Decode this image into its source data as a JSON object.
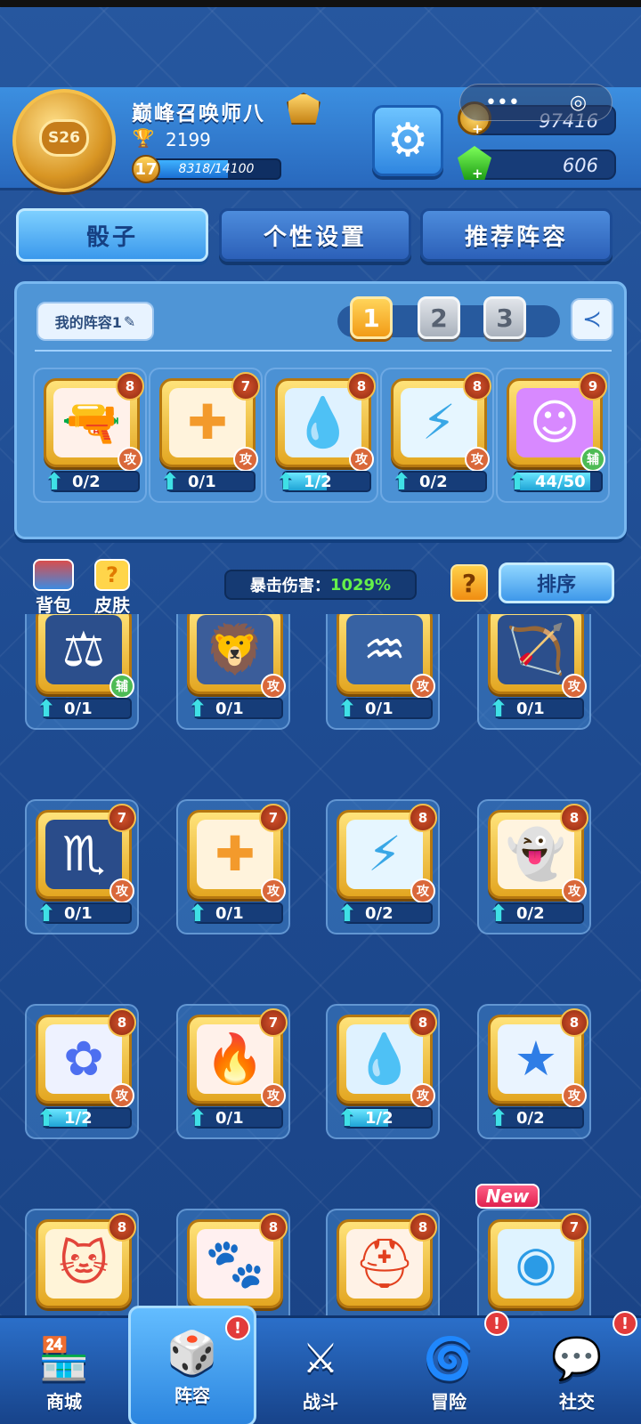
{
  "player": {
    "name": "巅峰召唤师八",
    "season_badge": "S26",
    "trophies": "2199",
    "level": "17",
    "xp_text": "8318/14100",
    "xp_fraction": 0.59
  },
  "currency": {
    "gold": "97416",
    "gems": "606"
  },
  "tabs": [
    {
      "label": "骰子",
      "active": true
    },
    {
      "label": "个性设置",
      "active": false
    },
    {
      "label": "推荐阵容",
      "active": false
    }
  ],
  "deck": {
    "name": "我的阵容1",
    "slots": [
      "1",
      "2",
      "3"
    ],
    "active_slot": 0,
    "cards": [
      {
        "icon": "🔫",
        "bg": "#fff1ea",
        "color": "#f05a28",
        "level": "8",
        "type": "攻",
        "type_kind": "atk",
        "progress": "0/2",
        "fill": 0
      },
      {
        "icon": "✚",
        "bg": "#fff3dc",
        "color": "#f39a2c",
        "level": "7",
        "type": "攻",
        "type_kind": "atk",
        "progress": "0/1",
        "fill": 0
      },
      {
        "icon": "💧",
        "bg": "#dff2ff",
        "color": "#2f9be6",
        "level": "8",
        "type": "攻",
        "type_kind": "atk",
        "progress": "1/2",
        "fill": 0.5
      },
      {
        "icon": "⚡",
        "bg": "#e6f6ff",
        "color": "#39a7e6",
        "level": "8",
        "type": "攻",
        "type_kind": "atk",
        "progress": "0/2",
        "fill": 0
      },
      {
        "icon": "☺",
        "bg": "#d889ff",
        "color": "#ffffff",
        "level": "9",
        "type": "辅",
        "type_kind": "sup",
        "progress": "44/50",
        "fill": 0.88
      }
    ]
  },
  "toolbar": {
    "bag_label": "背包",
    "skin_label": "皮肤",
    "crit_label": "暴击伤害：",
    "crit_value": "1029%",
    "help_label": "?",
    "sort_label": "排序"
  },
  "collection": [
    {
      "icon": "⚖",
      "bg": "#2c4f8c",
      "color": "#ffffff",
      "level": "",
      "type": "辅",
      "type_kind": "sup",
      "progress": "0/1",
      "fill": 0,
      "new": false
    },
    {
      "icon": "🦁",
      "bg": "#3b5d9a",
      "color": "#ffffff",
      "level": "",
      "type": "攻",
      "type_kind": "atk",
      "progress": "0/1",
      "fill": 0,
      "new": false
    },
    {
      "icon": "♒",
      "bg": "#3762a3",
      "color": "#ffffff",
      "level": "",
      "type": "攻",
      "type_kind": "atk",
      "progress": "0/1",
      "fill": 0,
      "new": false
    },
    {
      "icon": "🏹",
      "bg": "#2c4f8c",
      "color": "#ffffff",
      "level": "",
      "type": "攻",
      "type_kind": "atk",
      "progress": "0/1",
      "fill": 0,
      "new": false
    },
    {
      "icon": "♏",
      "bg": "#2a4c8a",
      "color": "#ffffff",
      "level": "7",
      "type": "攻",
      "type_kind": "atk",
      "progress": "0/1",
      "fill": 0,
      "new": false
    },
    {
      "icon": "✚",
      "bg": "#fff3dc",
      "color": "#f39a2c",
      "level": "7",
      "type": "攻",
      "type_kind": "atk",
      "progress": "0/1",
      "fill": 0,
      "new": false
    },
    {
      "icon": "⚡",
      "bg": "#e6f6ff",
      "color": "#39a7e6",
      "level": "8",
      "type": "攻",
      "type_kind": "atk",
      "progress": "0/2",
      "fill": 0,
      "new": false
    },
    {
      "icon": "👻",
      "bg": "#fff4df",
      "color": "#8b3df0",
      "level": "8",
      "type": "攻",
      "type_kind": "atk",
      "progress": "0/2",
      "fill": 0,
      "new": false
    },
    {
      "icon": "✿",
      "bg": "#eef2ff",
      "color": "#4d6ff0",
      "level": "8",
      "type": "攻",
      "type_kind": "atk",
      "progress": "1/2",
      "fill": 0.5,
      "new": false
    },
    {
      "icon": "🔥",
      "bg": "#fff1ea",
      "color": "#f04a1a",
      "level": "7",
      "type": "攻",
      "type_kind": "atk",
      "progress": "0/1",
      "fill": 0,
      "new": false
    },
    {
      "icon": "💧",
      "bg": "#dff2ff",
      "color": "#2f9be6",
      "level": "8",
      "type": "攻",
      "type_kind": "atk",
      "progress": "1/2",
      "fill": 0.5,
      "new": false
    },
    {
      "icon": "★",
      "bg": "#eaf4ff",
      "color": "#2f7de6",
      "level": "8",
      "type": "攻",
      "type_kind": "atk",
      "progress": "0/2",
      "fill": 0,
      "new": false
    },
    {
      "icon": "🐱",
      "bg": "#fff4d8",
      "color": "#e2453a",
      "level": "8",
      "type": "",
      "type_kind": "sup",
      "progress": "",
      "fill": 0,
      "new": false
    },
    {
      "icon": "🐾",
      "bg": "#fff0f0",
      "color": "#d8283a",
      "level": "8",
      "type": "",
      "type_kind": "sup",
      "progress": "",
      "fill": 0,
      "new": false
    },
    {
      "icon": "⛑",
      "bg": "#fff2e6",
      "color": "#e2401e",
      "level": "8",
      "type": "",
      "type_kind": "atk",
      "progress": "",
      "fill": 0,
      "new": false
    },
    {
      "icon": "◉",
      "bg": "#dff3ff",
      "color": "#2b9be6",
      "level": "7",
      "type": "",
      "type_kind": "atk",
      "progress": "",
      "fill": 0,
      "new": true,
      "new_label": "New"
    }
  ],
  "nav": [
    {
      "label": "商城",
      "icon": "🏪",
      "active": false,
      "alert": ""
    },
    {
      "label": "阵容",
      "icon": "🎲",
      "active": true,
      "alert": "!"
    },
    {
      "label": "战斗",
      "icon": "⚔",
      "active": false,
      "alert": ""
    },
    {
      "label": "冒险",
      "icon": "🌀",
      "active": false,
      "alert": "!"
    },
    {
      "label": "社交",
      "icon": "💬",
      "active": false,
      "alert": "!"
    }
  ],
  "miniprogram": {
    "menu": "•••",
    "close": "◎"
  }
}
